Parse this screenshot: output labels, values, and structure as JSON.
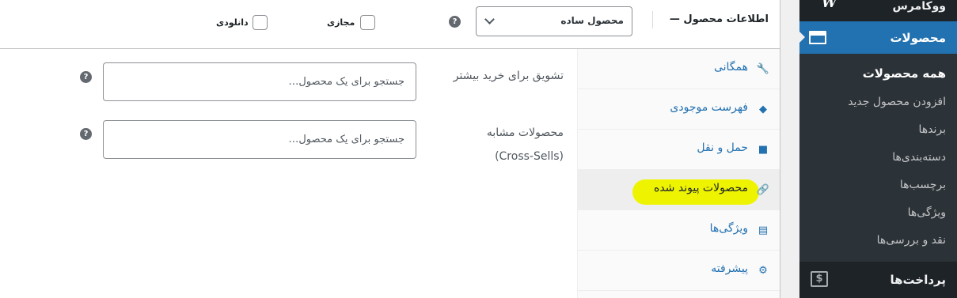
{
  "sidebar": {
    "brand": "ووکامرس",
    "brand_icon": "W",
    "active_menu": "محصولات",
    "submenu": [
      "همه محصولات",
      "افزودن محصول جدید",
      "برندها",
      "دسته‌بندی‌ها",
      "برچسب‌ها",
      "ویژگی‌ها",
      "نقد و بررسی‌ها"
    ],
    "payments": "پرداخت‌ها",
    "payments_icon": "$"
  },
  "product_data": {
    "title": "اطلاعات محصول —",
    "product_type": "محصول ساده",
    "virtual_label": "مجازی",
    "downloadable_label": "دانلودی",
    "help_glyph": "?"
  },
  "tabs": [
    {
      "label": "همگانی",
      "icon": "wrench-icon",
      "glyph": "🔧"
    },
    {
      "label": "فهرست موجودی",
      "icon": "tag-icon",
      "glyph": "◆"
    },
    {
      "label": "حمل و نقل",
      "icon": "truck-icon",
      "glyph": "■"
    },
    {
      "label": "محصولات پیوند شده",
      "icon": "link-icon",
      "glyph": "🔗"
    },
    {
      "label": "ویژگی‌ها",
      "icon": "list-icon",
      "glyph": "▤"
    },
    {
      "label": "پیشرفته",
      "icon": "gear-icon",
      "glyph": "⚙"
    }
  ],
  "fields": {
    "upsells_label": "تشویق برای خرید بیشتر",
    "upsells_placeholder": "جستجو برای یک محصول…",
    "crosssells_label": "محصولات مشابه",
    "crosssells_label_sub": "(Cross-Sells)",
    "crosssells_placeholder": "جستجو برای یک محصول…"
  },
  "colors": {
    "admin_bar": "#1d2327",
    "accent_blue": "#2271b1",
    "highlight_yellow": "#eef400"
  }
}
